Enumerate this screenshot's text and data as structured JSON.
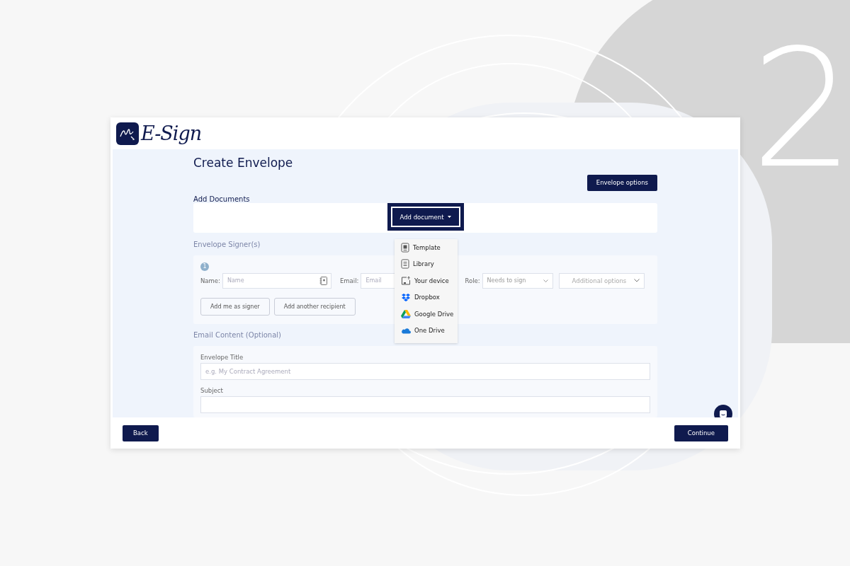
{
  "step_number": "2",
  "brand": {
    "name": "E-Sign"
  },
  "page_title": "Create Envelope",
  "envelope_options_button": "Envelope options",
  "documents": {
    "label": "Add Documents",
    "add_button": "Add document",
    "menu_open": true,
    "menu": [
      {
        "kind": "template",
        "label": "Template"
      },
      {
        "kind": "library",
        "label": "Library"
      },
      {
        "kind": "device",
        "label": "Your device"
      },
      {
        "kind": "dropbox",
        "label": "Dropbox"
      },
      {
        "kind": "gdrive",
        "label": "Google Drive"
      },
      {
        "kind": "onedrive",
        "label": "One Drive"
      }
    ]
  },
  "signers": {
    "label": "Envelope Signer(s)",
    "number": "1",
    "name_label": "Name:",
    "name_placeholder": "Name",
    "email_label": "Email:",
    "email_placeholder": "Email",
    "role_label": "Role:",
    "role_value": "Needs to sign",
    "additional_options": "Additional options",
    "buttons": [
      "Add me as signer",
      "Add another recipient"
    ]
  },
  "email_content": {
    "label": "Email Content (Optional)",
    "title_label": "Envelope Title",
    "title_placeholder": "e.g. My Contract Agreement",
    "subject_label": "Subject"
  },
  "footer": {
    "back": "Back",
    "continue": "Continue"
  }
}
